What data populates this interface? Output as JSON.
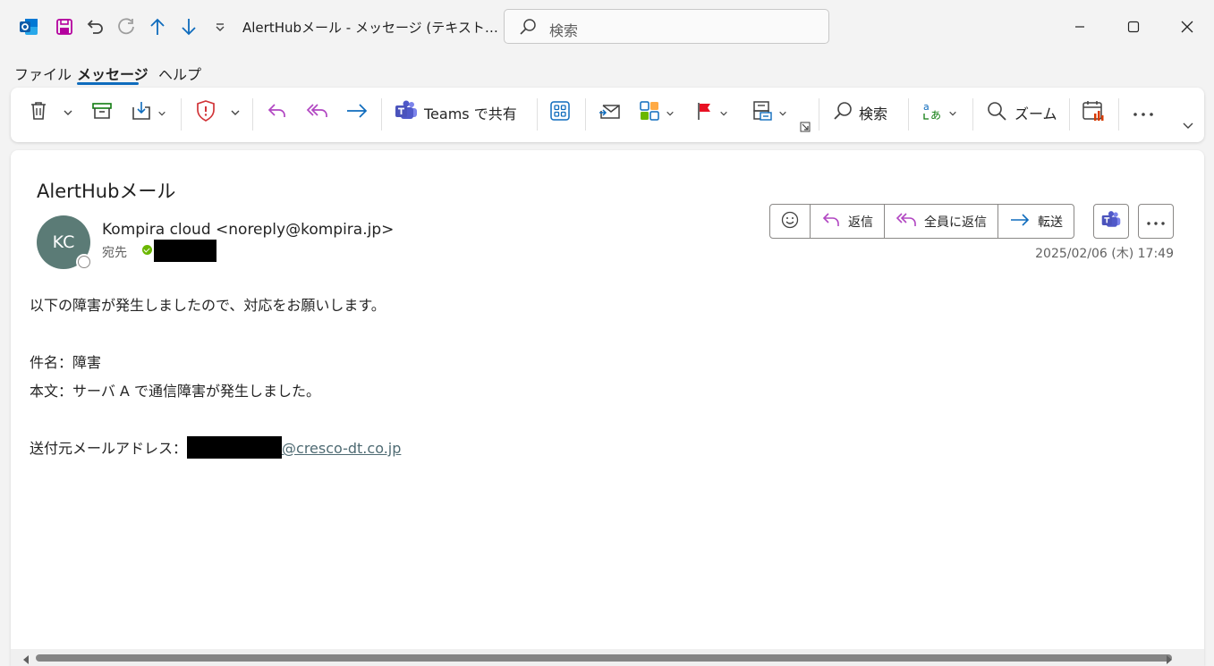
{
  "titlebar": {
    "title": "AlertHubメール  -  メッセージ (テキスト…",
    "search_placeholder": "検索",
    "icons": [
      "outlook-icon",
      "save-icon",
      "undo-icon",
      "redo-icon",
      "previous-item-icon",
      "next-item-icon",
      "customize-quick-access-icon"
    ],
    "window_controls": [
      "minimize",
      "maximize",
      "close"
    ]
  },
  "menu": {
    "tabs": [
      "ファイル",
      "メッセージ",
      "ヘルプ"
    ],
    "active_tab": "メッセージ"
  },
  "ribbon": {
    "teams_share_label": "Teams で共有",
    "search_label": "検索",
    "zoom_label": "ズーム",
    "icons": [
      "delete-icon",
      "archive-icon",
      "move-icon",
      "report-icon",
      "reply-icon",
      "reply-all-icon",
      "forward-icon",
      "teams-icon",
      "apps-icon",
      "read-unread-icon",
      "categorize-icon",
      "flag-icon",
      "policy-icon",
      "dialog-launcher-icon",
      "search-icon",
      "translate-icon",
      "zoom-icon",
      "viva-insights-icon",
      "more-icon",
      "expand-ribbon-icon"
    ],
    "accent": "#0f6cbd"
  },
  "message": {
    "subject": "AlertHubメール",
    "avatar_initials": "KC",
    "avatar_color": "#5b7b76",
    "sender": "Kompira cloud <noreply@kompira.jp>",
    "to_label": "宛先",
    "actions": {
      "reply": "返信",
      "reply_all": "全員に返信",
      "forward": "転送"
    },
    "datetime": "2025/02/06 (木) 17:49",
    "body": {
      "line1": "以下の障害が発生しましたので、対応をお願いします。",
      "line2": "件名：障害",
      "line3": "本文：サーバ A で通信障害が発生しました。",
      "line4_prefix": "送付元メールアドレス：",
      "line4_link_domain": "@cresco-dt.co.jp"
    }
  }
}
